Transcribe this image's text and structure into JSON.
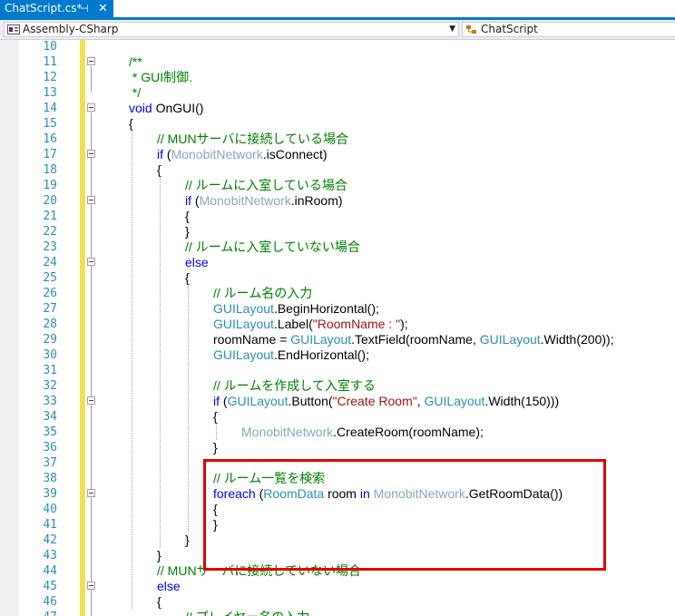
{
  "tab": {
    "title": "ChatScript.cs*",
    "pin_glyph": "⊣",
    "close_glyph": "✕"
  },
  "navigation": {
    "project": "Assembly-CSharp",
    "class": "ChatScript"
  },
  "colors": {
    "accent": "#007acc",
    "comment": "#008000",
    "keyword": "#0000ff",
    "type": "#2b91af",
    "highlight_border": "#e00000",
    "change_track": "#efe14f"
  },
  "icons": {
    "project": "csharp-project-icon",
    "class": "class-icon",
    "dropdown": "chevron-down-icon"
  },
  "code": {
    "lines": [
      {
        "num": "10",
        "fold": false,
        "indent": 0,
        "tokens": []
      },
      {
        "num": "11",
        "fold": true,
        "indent": 0,
        "tokens": [
          {
            "t": "/**",
            "c": "comment"
          }
        ]
      },
      {
        "num": "12",
        "fold": false,
        "indent": 0,
        "tokens": [
          {
            "t": " * GUI制御.",
            "c": "comment"
          }
        ]
      },
      {
        "num": "13",
        "fold": false,
        "indent": 0,
        "tokens": [
          {
            "t": " */",
            "c": "comment"
          }
        ]
      },
      {
        "num": "14",
        "fold": true,
        "indent": 0,
        "tokens": [
          {
            "t": "void",
            "c": "kw"
          },
          {
            "t": " OnGUI()",
            "c": "plain"
          }
        ]
      },
      {
        "num": "15",
        "fold": false,
        "indent": 0,
        "tokens": [
          {
            "t": "{",
            "c": "plain"
          }
        ]
      },
      {
        "num": "16",
        "fold": false,
        "indent": 1,
        "tokens": [
          {
            "t": "// MUNサーバに接続している場合",
            "c": "comment"
          }
        ]
      },
      {
        "num": "17",
        "fold": true,
        "indent": 1,
        "tokens": [
          {
            "t": "if",
            "c": "kw"
          },
          {
            "t": " (",
            "c": "plain"
          },
          {
            "t": "MonobitNetwork",
            "c": "dim"
          },
          {
            "t": ".isConnect)",
            "c": "plain"
          }
        ]
      },
      {
        "num": "18",
        "fold": false,
        "indent": 1,
        "tokens": [
          {
            "t": "{",
            "c": "plain"
          }
        ]
      },
      {
        "num": "19",
        "fold": false,
        "indent": 2,
        "tokens": [
          {
            "t": "// ルームに入室している場合",
            "c": "comment"
          }
        ]
      },
      {
        "num": "20",
        "fold": true,
        "indent": 2,
        "tokens": [
          {
            "t": "if",
            "c": "kw"
          },
          {
            "t": " (",
            "c": "plain"
          },
          {
            "t": "MonobitNetwork",
            "c": "dim"
          },
          {
            "t": ".inRoom)",
            "c": "plain"
          }
        ]
      },
      {
        "num": "21",
        "fold": false,
        "indent": 2,
        "tokens": [
          {
            "t": "{",
            "c": "plain"
          }
        ]
      },
      {
        "num": "22",
        "fold": false,
        "indent": 2,
        "tokens": [
          {
            "t": "}",
            "c": "plain"
          }
        ]
      },
      {
        "num": "23",
        "fold": false,
        "indent": 2,
        "tokens": [
          {
            "t": "// ルームに入室していない場合",
            "c": "comment"
          }
        ]
      },
      {
        "num": "24",
        "fold": true,
        "indent": 2,
        "tokens": [
          {
            "t": "else",
            "c": "kw"
          }
        ]
      },
      {
        "num": "25",
        "fold": false,
        "indent": 2,
        "tokens": [
          {
            "t": "{",
            "c": "plain"
          }
        ]
      },
      {
        "num": "26",
        "fold": false,
        "indent": 3,
        "tokens": [
          {
            "t": "// ルーム名の入力",
            "c": "comment"
          }
        ]
      },
      {
        "num": "27",
        "fold": false,
        "indent": 3,
        "tokens": [
          {
            "t": "GUILayout",
            "c": "type"
          },
          {
            "t": ".BeginHorizontal();",
            "c": "plain"
          }
        ]
      },
      {
        "num": "28",
        "fold": false,
        "indent": 3,
        "tokens": [
          {
            "t": "GUILayout",
            "c": "type"
          },
          {
            "t": ".Label(",
            "c": "plain"
          },
          {
            "t": "\"RoomName : \"",
            "c": "str"
          },
          {
            "t": ");",
            "c": "plain"
          }
        ]
      },
      {
        "num": "29",
        "fold": false,
        "indent": 3,
        "tokens": [
          {
            "t": "roomName = ",
            "c": "plain"
          },
          {
            "t": "GUILayout",
            "c": "type"
          },
          {
            "t": ".TextField(roomName, ",
            "c": "plain"
          },
          {
            "t": "GUILayout",
            "c": "type"
          },
          {
            "t": ".Width(200));",
            "c": "plain"
          }
        ]
      },
      {
        "num": "30",
        "fold": false,
        "indent": 3,
        "tokens": [
          {
            "t": "GUILayout",
            "c": "type"
          },
          {
            "t": ".EndHorizontal();",
            "c": "plain"
          }
        ]
      },
      {
        "num": "31",
        "fold": false,
        "indent": 3,
        "tokens": []
      },
      {
        "num": "32",
        "fold": false,
        "indent": 3,
        "tokens": [
          {
            "t": "// ルームを作成して入室する",
            "c": "comment"
          }
        ]
      },
      {
        "num": "33",
        "fold": true,
        "indent": 3,
        "tokens": [
          {
            "t": "if",
            "c": "kw"
          },
          {
            "t": " (",
            "c": "plain"
          },
          {
            "t": "GUILayout",
            "c": "type"
          },
          {
            "t": ".Button(",
            "c": "plain"
          },
          {
            "t": "\"Create Room\"",
            "c": "str"
          },
          {
            "t": ", ",
            "c": "plain"
          },
          {
            "t": "GUILayout",
            "c": "type"
          },
          {
            "t": ".Width(150)))",
            "c": "plain"
          }
        ]
      },
      {
        "num": "34",
        "fold": false,
        "indent": 3,
        "tokens": [
          {
            "t": "{",
            "c": "plain"
          }
        ]
      },
      {
        "num": "35",
        "fold": false,
        "indent": 4,
        "tokens": [
          {
            "t": "MonobitNetwork",
            "c": "dim"
          },
          {
            "t": ".CreateRoom(roomName);",
            "c": "plain"
          }
        ]
      },
      {
        "num": "36",
        "fold": false,
        "indent": 3,
        "tokens": [
          {
            "t": "}",
            "c": "plain"
          }
        ]
      },
      {
        "num": "37",
        "fold": false,
        "indent": 3,
        "tokens": []
      },
      {
        "num": "38",
        "fold": false,
        "indent": 3,
        "tokens": [
          {
            "t": "// ルーム一覧を検索",
            "c": "comment"
          }
        ]
      },
      {
        "num": "39",
        "fold": true,
        "indent": 3,
        "tokens": [
          {
            "t": "foreach",
            "c": "kw"
          },
          {
            "t": " (",
            "c": "plain"
          },
          {
            "t": "RoomData",
            "c": "type"
          },
          {
            "t": " room ",
            "c": "plain"
          },
          {
            "t": "in",
            "c": "kw"
          },
          {
            "t": " ",
            "c": "plain"
          },
          {
            "t": "MonobitNetwork",
            "c": "dim"
          },
          {
            "t": ".GetRoomData())",
            "c": "plain"
          }
        ]
      },
      {
        "num": "40",
        "fold": false,
        "indent": 3,
        "tokens": [
          {
            "t": "{",
            "c": "plain"
          }
        ]
      },
      {
        "num": "41",
        "fold": false,
        "indent": 3,
        "tokens": [
          {
            "t": "}",
            "c": "plain"
          }
        ]
      },
      {
        "num": "42",
        "fold": false,
        "indent": 2,
        "tokens": [
          {
            "t": "}",
            "c": "plain"
          }
        ]
      },
      {
        "num": "43",
        "fold": false,
        "indent": 1,
        "tokens": [
          {
            "t": "}",
            "c": "plain"
          }
        ]
      },
      {
        "num": "44",
        "fold": false,
        "indent": 1,
        "tokens": [
          {
            "t": "// MUNサーバに接続していない場合",
            "c": "comment"
          }
        ]
      },
      {
        "num": "45",
        "fold": true,
        "indent": 1,
        "tokens": [
          {
            "t": "else",
            "c": "kw"
          }
        ]
      },
      {
        "num": "46",
        "fold": false,
        "indent": 1,
        "tokens": [
          {
            "t": "{",
            "c": "plain"
          }
        ]
      },
      {
        "num": "47",
        "fold": false,
        "indent": 2,
        "tokens": [
          {
            "t": "// プレイヤー名の入力",
            "c": "comment"
          }
        ]
      }
    ]
  }
}
